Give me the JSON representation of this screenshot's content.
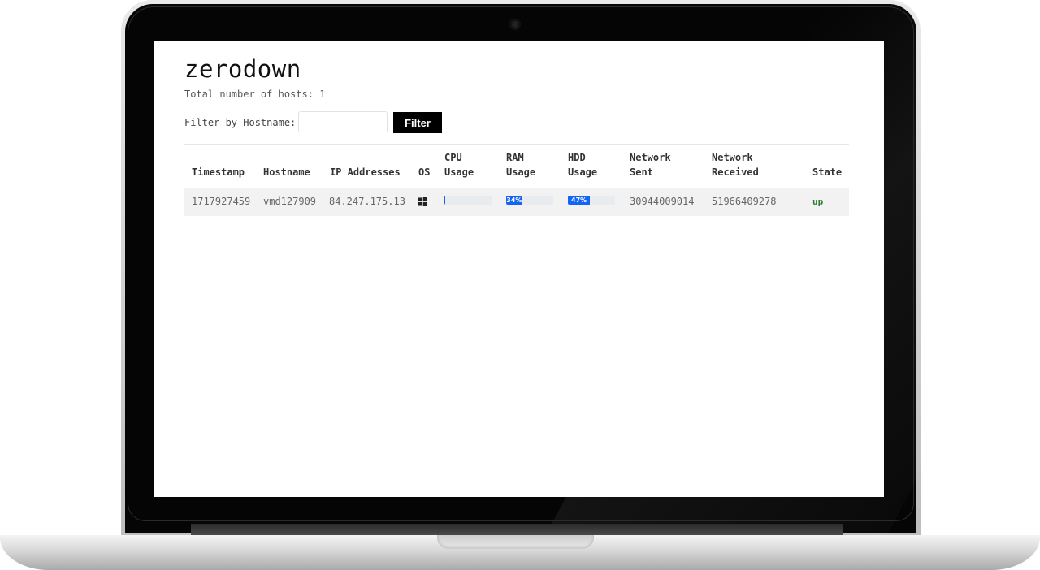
{
  "app": {
    "title": "zerodown"
  },
  "summary": {
    "total_label": "Total number of hosts:",
    "total_count": "1"
  },
  "filter": {
    "label": "Filter by Hostname:",
    "input_value": "",
    "placeholder": "",
    "button_label": "Filter"
  },
  "table": {
    "headers": {
      "timestamp": "Timestamp",
      "hostname": "Hostname",
      "ip": "IP Addresses",
      "os": "OS",
      "cpu_1": "CPU",
      "cpu_2": "Usage",
      "ram_1": "RAM",
      "ram_2": "Usage",
      "hdd_1": "HDD",
      "hdd_2": "Usage",
      "net_sent_1": "Network",
      "net_sent_2": "Sent",
      "net_recv_1": "Network",
      "net_recv_2": "Received",
      "state": "State"
    },
    "rows": [
      {
        "timestamp": "1717927459",
        "hostname": "vmd127909",
        "ip": "84.247.175.13",
        "os_icon": "windows-icon",
        "cpu_percent": 1,
        "cpu_label": "",
        "ram_percent": 34,
        "ram_label": "34%",
        "hdd_percent": 47,
        "hdd_label": "47%",
        "network_sent": "30944009014",
        "network_received": "51966409278",
        "state": "up"
      }
    ]
  },
  "colors": {
    "progress": "#1565f5",
    "state_up": "#2e7d32",
    "filter_button": "#000000"
  }
}
